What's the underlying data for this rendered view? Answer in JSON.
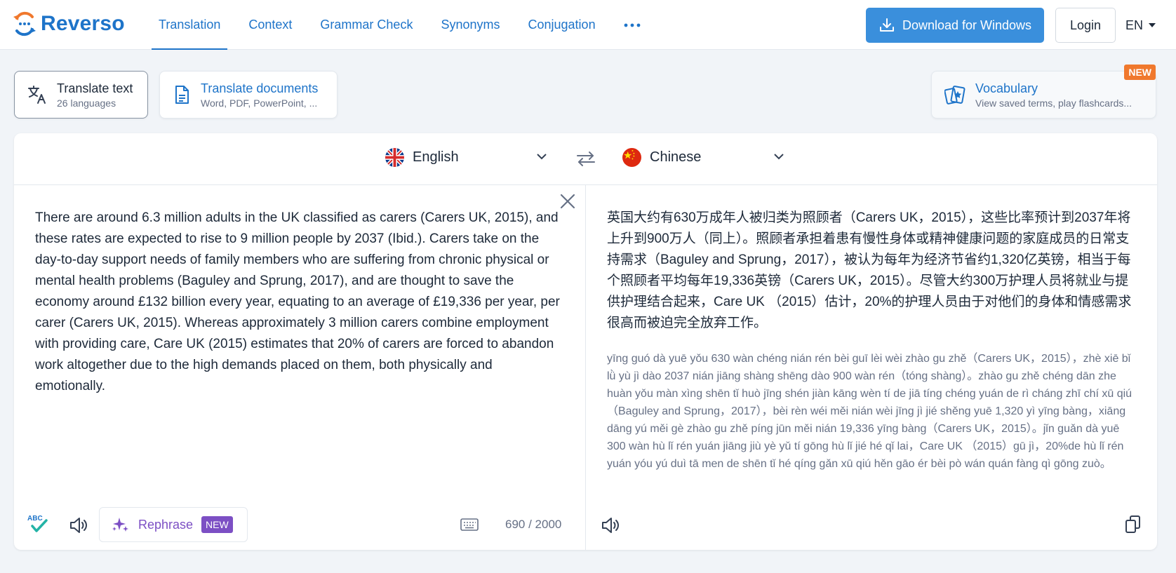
{
  "header": {
    "brand": "Reverso",
    "nav": [
      {
        "label": "Translation",
        "active": true
      },
      {
        "label": "Context"
      },
      {
        "label": "Grammar Check"
      },
      {
        "label": "Synonyms"
      },
      {
        "label": "Conjugation"
      }
    ],
    "more_icon": "more-dots-icon",
    "download_label": "Download for Windows",
    "login_label": "Login",
    "language": "EN"
  },
  "modes": {
    "text": {
      "title": "Translate text",
      "subtitle": "26 languages"
    },
    "docs": {
      "title": "Translate documents",
      "subtitle": "Word, PDF, PowerPoint, ..."
    },
    "vocab": {
      "title": "Vocabulary",
      "subtitle": "View saved terms, play flashcards...",
      "badge": "NEW"
    }
  },
  "translator": {
    "source_lang": "English",
    "target_lang": "Chinese",
    "source_text": "There are around 6.3 million adults in the UK classified as carers (Carers UK, 2015), and these rates are expected to rise to 9 million people by 2037 (Ibid.). Carers take on the day-to-day support needs of family members who are suffering from chronic physical or mental health problems (Baguley and Sprung, 2017), and are thought to save the economy around £132 billion every year, equating to an average of £19,336 per year, per carer (Carers UK, 2015). Whereas approximately 3 million carers combine employment with providing care, Care UK (2015) estimates that 20% of carers are forced to abandon work altogether due to the high demands placed on them, both physically and emotionally.",
    "target_text": "英国大约有630万成年人被归类为照顾者（Carers UK，2015），这些比率预计到2037年将上升到900万人（同上）。照顾者承担着患有慢性身体或精神健康问题的家庭成员的日常支持需求（Baguley and Sprung，2017），被认为每年为经济节省约1,320亿英镑，相当于每个照顾者平均每年19,336英镑（Carers UK，2015）。尽管大约300万护理人员将就业与提供护理结合起来，Care UK （2015）估计，20%的护理人员由于对他们的身体和情感需求很高而被迫完全放弃工作。",
    "pinyin": "yīng guó dà yuē yǒu 630 wàn chéng nián rén bèi guī lèi wèi zhào gu zhě（Carers UK，2015），zhè xiē bǐ lǜ yù jì dào 2037 nián jiāng shàng shēng dào 900 wàn rén（tóng shàng）。zhào gu zhě chéng dān zhe huàn yǒu màn xìng shēn tǐ huò jīng shén jiàn kāng wèn tí de jiā tíng chéng yuán de rì cháng zhī chí xū qiú（Baguley and Sprung，2017），bèi rèn wéi měi nián wèi jīng jì jié shěng yuē 1,320 yì yīng bàng，xiāng dāng yú měi gè zhào gu zhě píng jūn měi nián 19,336 yīng bàng（Carers UK，2015）。jǐn guǎn dà yuē 300 wàn hù lǐ rén yuán jiāng jiù yè yǔ tí gōng hù lǐ jié hé qǐ lai，Care UK （2015）gū jì，20%de hù lǐ rén yuán yóu yú duì tā men de shēn tǐ hé qíng gǎn xū qiú hěn gāo ér bèi pò wán quán fàng qì gōng zuò。",
    "rephrase_label": "Rephrase",
    "rephrase_badge": "NEW",
    "char_count": "690 / 2000"
  },
  "colors": {
    "brand": "#1e74c9",
    "accent_orange": "#f0782d",
    "rephrase": "#7c4fc4",
    "download_bg": "#3a8fdc"
  }
}
